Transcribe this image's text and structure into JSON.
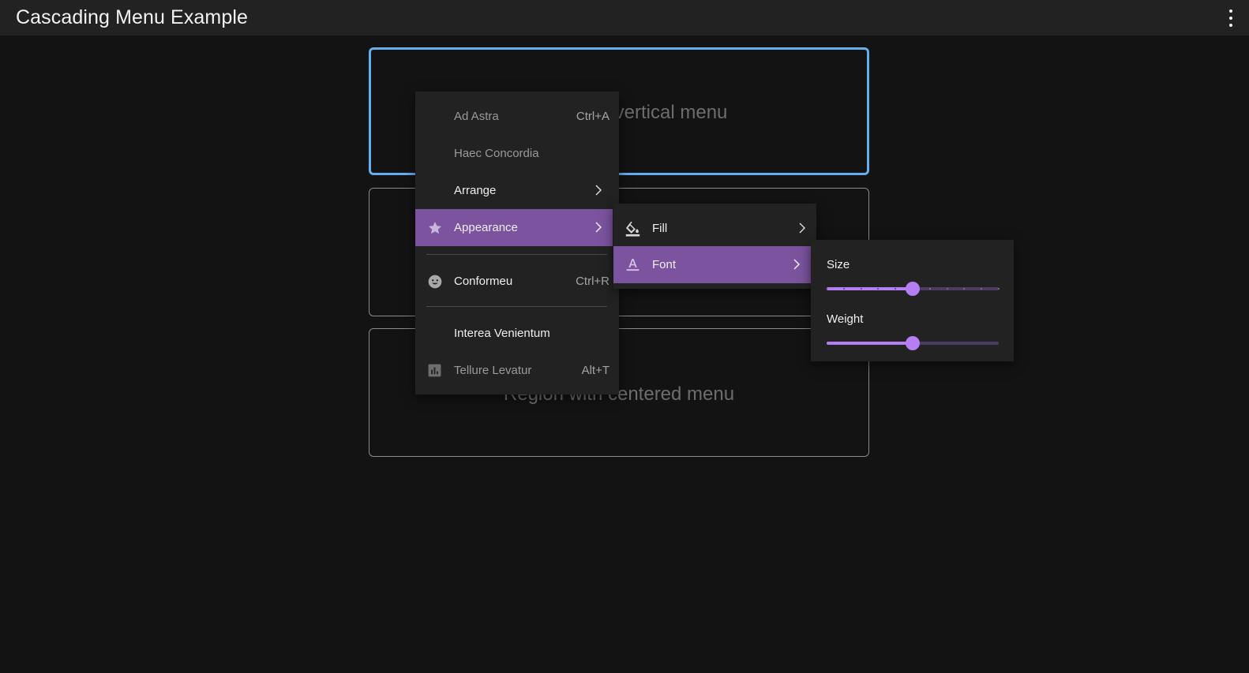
{
  "app": {
    "title": "Cascading Menu Example"
  },
  "regions": {
    "top_label": "Region with vertical menu",
    "middle_label": "",
    "bottom_label": "Region with centered menu"
  },
  "menu": {
    "items": [
      {
        "label": "Ad Astra",
        "shortcut": "Ctrl+A",
        "state": "disabled"
      },
      {
        "label": "Haec Concordia",
        "shortcut": "",
        "state": "disabled"
      },
      {
        "label": "Arrange",
        "shortcut": "",
        "state": "enabled",
        "submenu": true
      },
      {
        "label": "Appearance",
        "shortcut": "",
        "state": "selected",
        "icon": "star-icon",
        "submenu": true
      },
      {
        "label": "Conformeu",
        "shortcut": "Ctrl+R",
        "state": "enabled",
        "icon": "smiley-face-icon"
      },
      {
        "label": "Interea Venientum",
        "shortcut": "",
        "state": "enabled"
      },
      {
        "label": "Tellure Levatur",
        "shortcut": "Alt+T",
        "state": "disabled",
        "icon": "bar-chart-icon"
      }
    ]
  },
  "submenu": {
    "items": [
      {
        "label": "Fill",
        "icon": "paint-bucket-icon",
        "submenu": true
      },
      {
        "label": "Font",
        "icon": "text-format-icon",
        "submenu": true,
        "state": "selected"
      }
    ]
  },
  "font_panel": {
    "size_label": "Size",
    "size_value": 0.5,
    "size_steps": 10,
    "weight_label": "Weight",
    "weight_value": 0.5
  },
  "colors": {
    "accent": "#b57ef5",
    "selected_bg": "#7b539e",
    "focus_border": "#64aef0",
    "background": "#131313",
    "menu_bg": "#222222"
  }
}
